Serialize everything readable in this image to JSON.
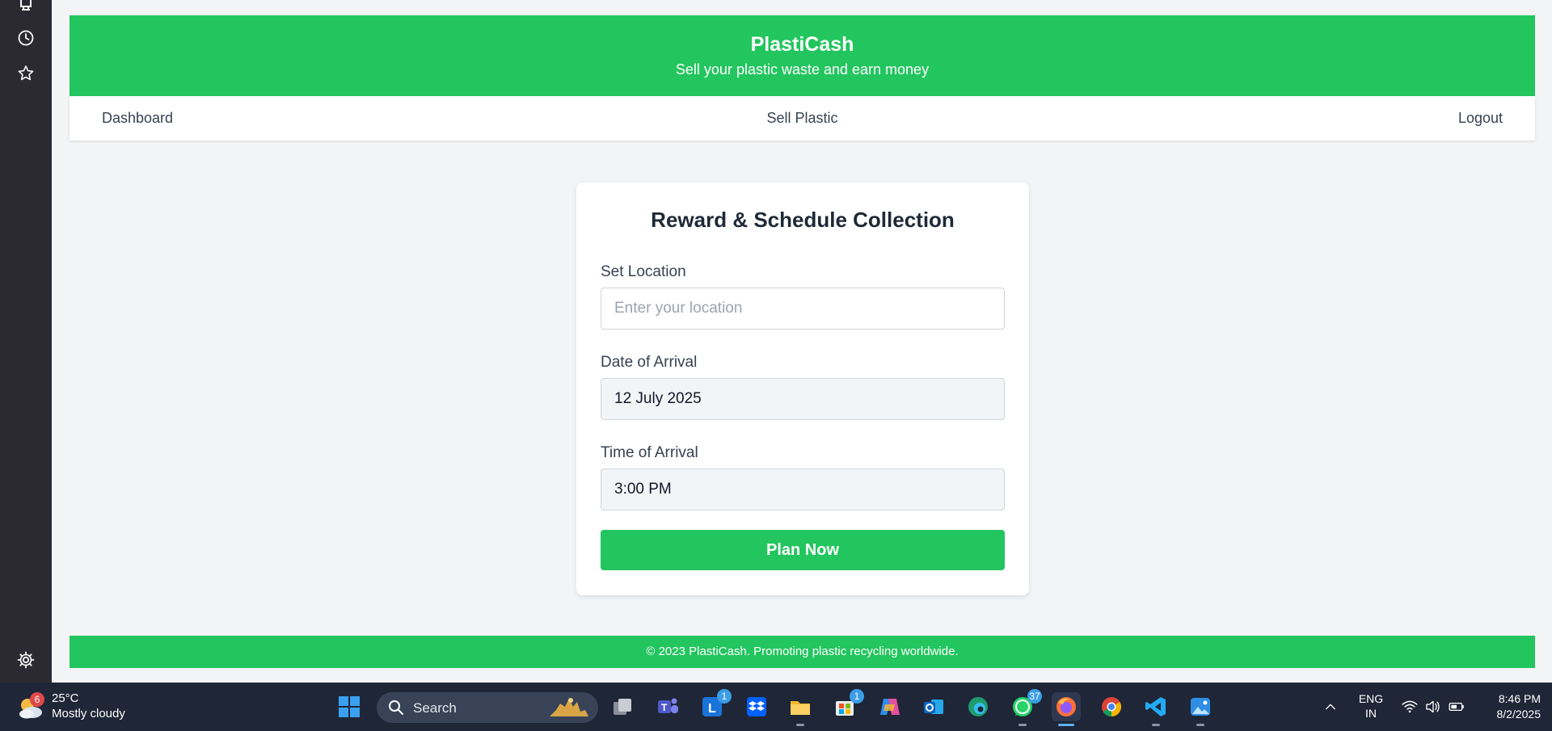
{
  "app": {
    "title": "PlastiCash",
    "subtitle": "Sell your plastic waste and earn money"
  },
  "nav": {
    "dashboard": "Dashboard",
    "sell_plastic": "Sell Plastic",
    "logout": "Logout"
  },
  "form": {
    "heading": "Reward & Schedule Collection",
    "location_label": "Set Location",
    "location_placeholder": "Enter your location",
    "location_value": "",
    "date_label": "Date of Arrival",
    "date_value": "12 July 2025",
    "time_label": "Time of Arrival",
    "time_value": "3:00 PM",
    "submit_label": "Plan Now"
  },
  "footer": {
    "text": "© 2023 PlastiCash. Promoting plastic recycling worldwide."
  },
  "sidebar": {
    "icons": [
      "reader-icon",
      "history-icon",
      "bookmark-star-icon",
      "settings-gear-icon"
    ]
  },
  "taskbar": {
    "weather": {
      "badge": "6",
      "temp": "25°C",
      "condition": "Mostly cloudy"
    },
    "search_label": "Search",
    "badges": {
      "l_app": "1",
      "store": "1",
      "whatsapp": "37"
    },
    "language": {
      "line1": "ENG",
      "line2": "IN"
    },
    "clock": {
      "time": "8:46 PM",
      "date": "8/2/2025"
    }
  },
  "colors": {
    "brand_green": "#22c55e",
    "page_bg": "#f3f4f6",
    "taskbar_bg": "#1e2637",
    "rail_bg": "#2b2a33"
  }
}
